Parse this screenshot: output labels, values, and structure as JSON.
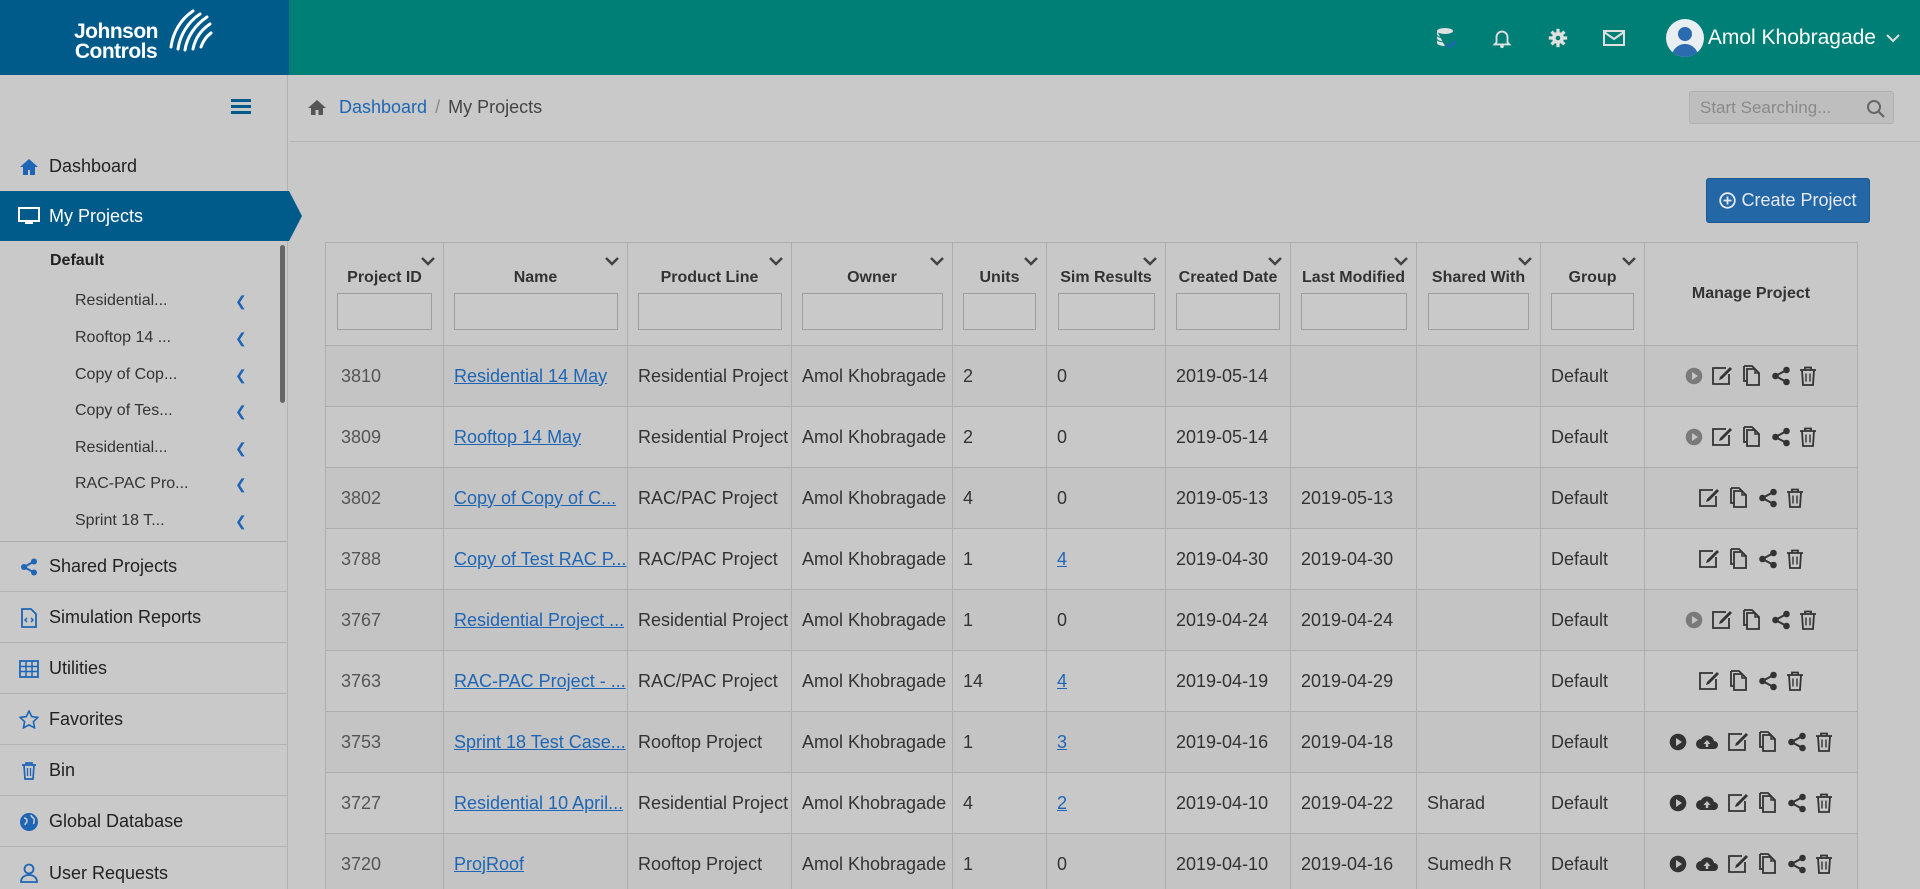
{
  "brand": {
    "line1": "Johnson",
    "line2": "Controls"
  },
  "header": {
    "icons": [
      "database-icon",
      "bell-icon",
      "gear-icon",
      "envelope-icon"
    ],
    "user": {
      "name": "Amol Khobragade"
    }
  },
  "sidebar": {
    "items": [
      {
        "label": "Dashboard",
        "icon": "home-icon"
      },
      {
        "label": "My Projects",
        "icon": "monitor-icon",
        "active": true
      },
      {
        "label": "Shared Projects",
        "icon": "share-icon"
      },
      {
        "label": "Simulation Reports",
        "icon": "report-icon"
      },
      {
        "label": "Utilities",
        "icon": "grid-icon"
      },
      {
        "label": "Favorites",
        "icon": "star-icon"
      },
      {
        "label": "Bin",
        "icon": "trash-icon"
      },
      {
        "label": "Global Database",
        "icon": "globe-icon"
      },
      {
        "label": "User Requests",
        "icon": "user-icon"
      }
    ],
    "group": "Default",
    "sub_items": [
      {
        "label": "Residential..."
      },
      {
        "label": "Rooftop 14 ..."
      },
      {
        "label": "Copy of Cop..."
      },
      {
        "label": "Copy of Tes..."
      },
      {
        "label": "Residential..."
      },
      {
        "label": "RAC-PAC Pro..."
      },
      {
        "label": "Sprint 18 T..."
      }
    ]
  },
  "breadcrumb": {
    "home": "Dashboard",
    "sep": "/",
    "current": "My Projects"
  },
  "search": {
    "placeholder": "Start Searching..."
  },
  "create_button": {
    "label": "Create Project"
  },
  "table": {
    "columns": [
      "Project ID",
      "Name",
      "Product Line",
      "Owner",
      "Units",
      "Sim Results",
      "Created Date",
      "Last Modified",
      "Shared With",
      "Group",
      "Manage Project"
    ],
    "rows": [
      {
        "id": "3810",
        "name": "Residential 14 May",
        "product": "Residential Project",
        "owner": "Amol Khobragade",
        "units": "2",
        "sim": "0",
        "created": "2019-05-14",
        "modified": "",
        "shared": "",
        "group": "Default"
      },
      {
        "id": "3809",
        "name": "Rooftop 14 May",
        "product": "Residential Project",
        "owner": "Amol Khobragade",
        "units": "2",
        "sim": "0",
        "created": "2019-05-14",
        "modified": "",
        "shared": "",
        "group": "Default"
      },
      {
        "id": "3802",
        "name": "Copy of Copy of C...",
        "product": "RAC/PAC Project",
        "owner": "Amol Khobragade",
        "units": "4",
        "sim": "0",
        "created": "2019-05-13",
        "modified": "2019-05-13",
        "shared": "",
        "group": "Default"
      },
      {
        "id": "3788",
        "name": "Copy of Test RAC P...",
        "product": "RAC/PAC Project",
        "owner": "Amol Khobragade",
        "units": "1",
        "sim": "4",
        "created": "2019-04-30",
        "modified": "2019-04-30",
        "shared": "",
        "group": "Default"
      },
      {
        "id": "3767",
        "name": "Residential Project ...",
        "product": "Residential Project",
        "owner": "Amol Khobragade",
        "units": "1",
        "sim": "0",
        "created": "2019-04-24",
        "modified": "2019-04-24",
        "shared": "",
        "group": "Default"
      },
      {
        "id": "3763",
        "name": "RAC-PAC Project - ...",
        "product": "RAC/PAC Project",
        "owner": "Amol Khobragade",
        "units": "14",
        "sim": "4",
        "created": "2019-04-19",
        "modified": "2019-04-29",
        "shared": "",
        "group": "Default"
      },
      {
        "id": "3753",
        "name": "Sprint 18 Test Case...",
        "product": "Rooftop Project",
        "owner": "Amol Khobragade",
        "units": "1",
        "sim": "3",
        "created": "2019-04-16",
        "modified": "2019-04-18",
        "shared": "",
        "group": "Default"
      },
      {
        "id": "3727",
        "name": "Residential 10 April...",
        "product": "Residential Project",
        "owner": "Amol Khobragade",
        "units": "4",
        "sim": "2",
        "created": "2019-04-10",
        "modified": "2019-04-22",
        "shared": "Sharad",
        "group": "Default"
      },
      {
        "id": "3720",
        "name": "ProjRoof",
        "product": "Rooftop Project",
        "owner": "Amol Khobragade",
        "units": "1",
        "sim": "0",
        "created": "2019-04-10",
        "modified": "2019-04-16",
        "shared": "Sumedh R",
        "group": "Default"
      }
    ]
  }
}
